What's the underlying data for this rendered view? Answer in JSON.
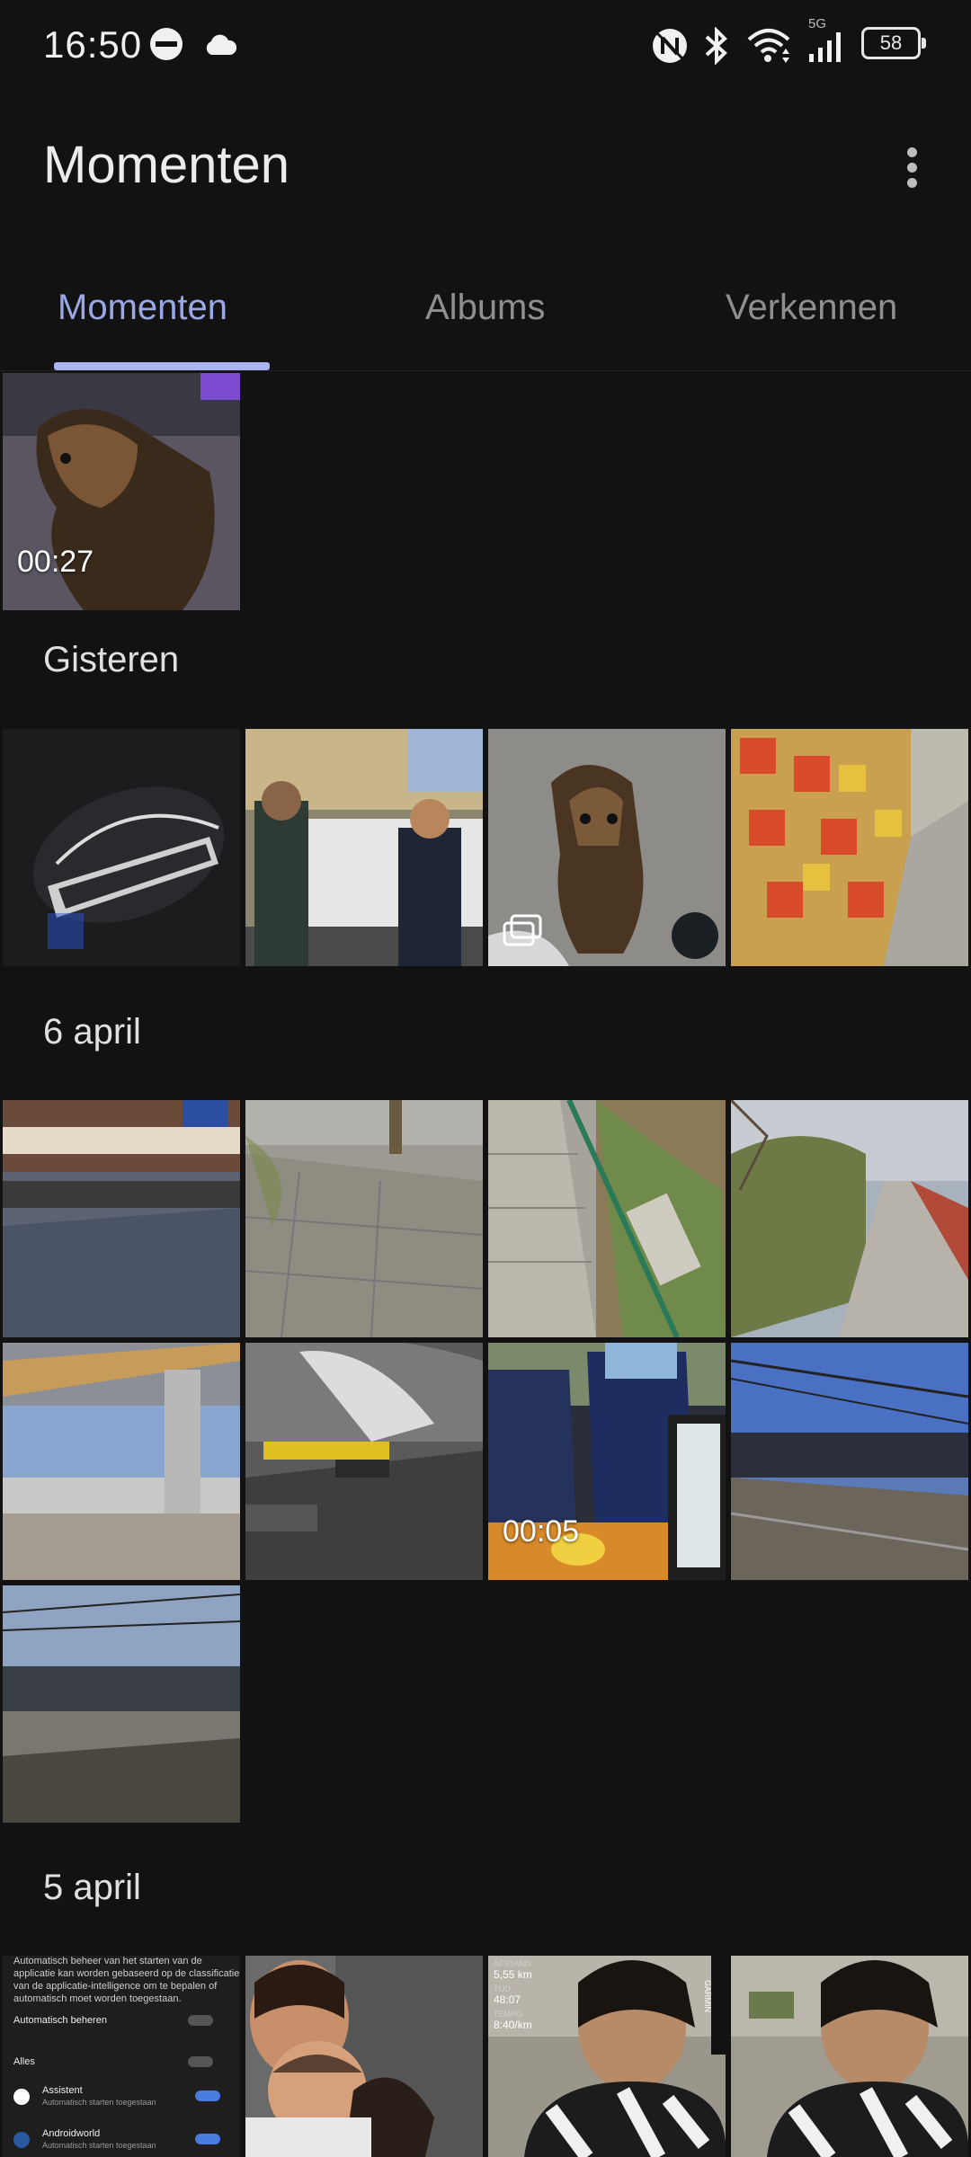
{
  "status_bar": {
    "time": "16:50",
    "network_label": "5G",
    "battery_level": "58",
    "icons": [
      "do-not-disturb-icon",
      "cloud-icon",
      "nfc-icon",
      "bluetooth-icon",
      "wifi-icon",
      "signal-icon",
      "battery-icon"
    ]
  },
  "header": {
    "title": "Momenten",
    "menu_icon": "more-vert-icon"
  },
  "tabs": [
    {
      "label": "Momenten",
      "active": true
    },
    {
      "label": "Albums",
      "active": false
    },
    {
      "label": "Verkennen",
      "active": false
    }
  ],
  "colors": {
    "background": "#121212",
    "accent": "#9aa8e8",
    "indicator": "#a9b4f0"
  },
  "sections": [
    {
      "label": "",
      "items": [
        {
          "kind": "video",
          "duration": "00:27",
          "subject": "dog"
        }
      ]
    },
    {
      "label": "Gisteren",
      "items": [
        {
          "kind": "photo",
          "subject": "shirt"
        },
        {
          "kind": "photo",
          "subject": "street"
        },
        {
          "kind": "burst",
          "subject": "dog"
        },
        {
          "kind": "photo",
          "subject": "shelf"
        }
      ]
    },
    {
      "label": "6 april",
      "items": [
        {
          "kind": "photo"
        },
        {
          "kind": "photo"
        },
        {
          "kind": "photo"
        },
        {
          "kind": "photo"
        },
        {
          "kind": "photo"
        },
        {
          "kind": "photo"
        },
        {
          "kind": "video",
          "duration": "00:05"
        },
        {
          "kind": "photo"
        },
        {
          "kind": "photo"
        }
      ]
    },
    {
      "label": "5 april",
      "items": [
        {
          "kind": "screenshot"
        },
        {
          "kind": "photo"
        },
        {
          "kind": "photo"
        },
        {
          "kind": "photo"
        }
      ]
    }
  ],
  "screenshot_text": {
    "line1": "Automatisch beheer van het starten van de",
    "line2": "applicatie kan worden gebaseerd op de classificatie",
    "line3": "van de applicatie-intelligence om te bepalen of",
    "line4": "automatisch moet worden toegestaan.",
    "auto_manage": "Automatisch beheren",
    "all": "Alles",
    "app1": "Assistent",
    "app1_sub": "Automatisch starten toegestaan",
    "app2": "Androidworld",
    "app2_sub": "Automatisch starten toegestaan"
  },
  "fitness_overlay": {
    "distance_label": "AFSTAND",
    "distance": "5,55 km",
    "time_label": "TIJD",
    "time": "48:07",
    "pace_label": "TEMPO",
    "pace": "8:40/km",
    "brand": "GARMIN"
  }
}
